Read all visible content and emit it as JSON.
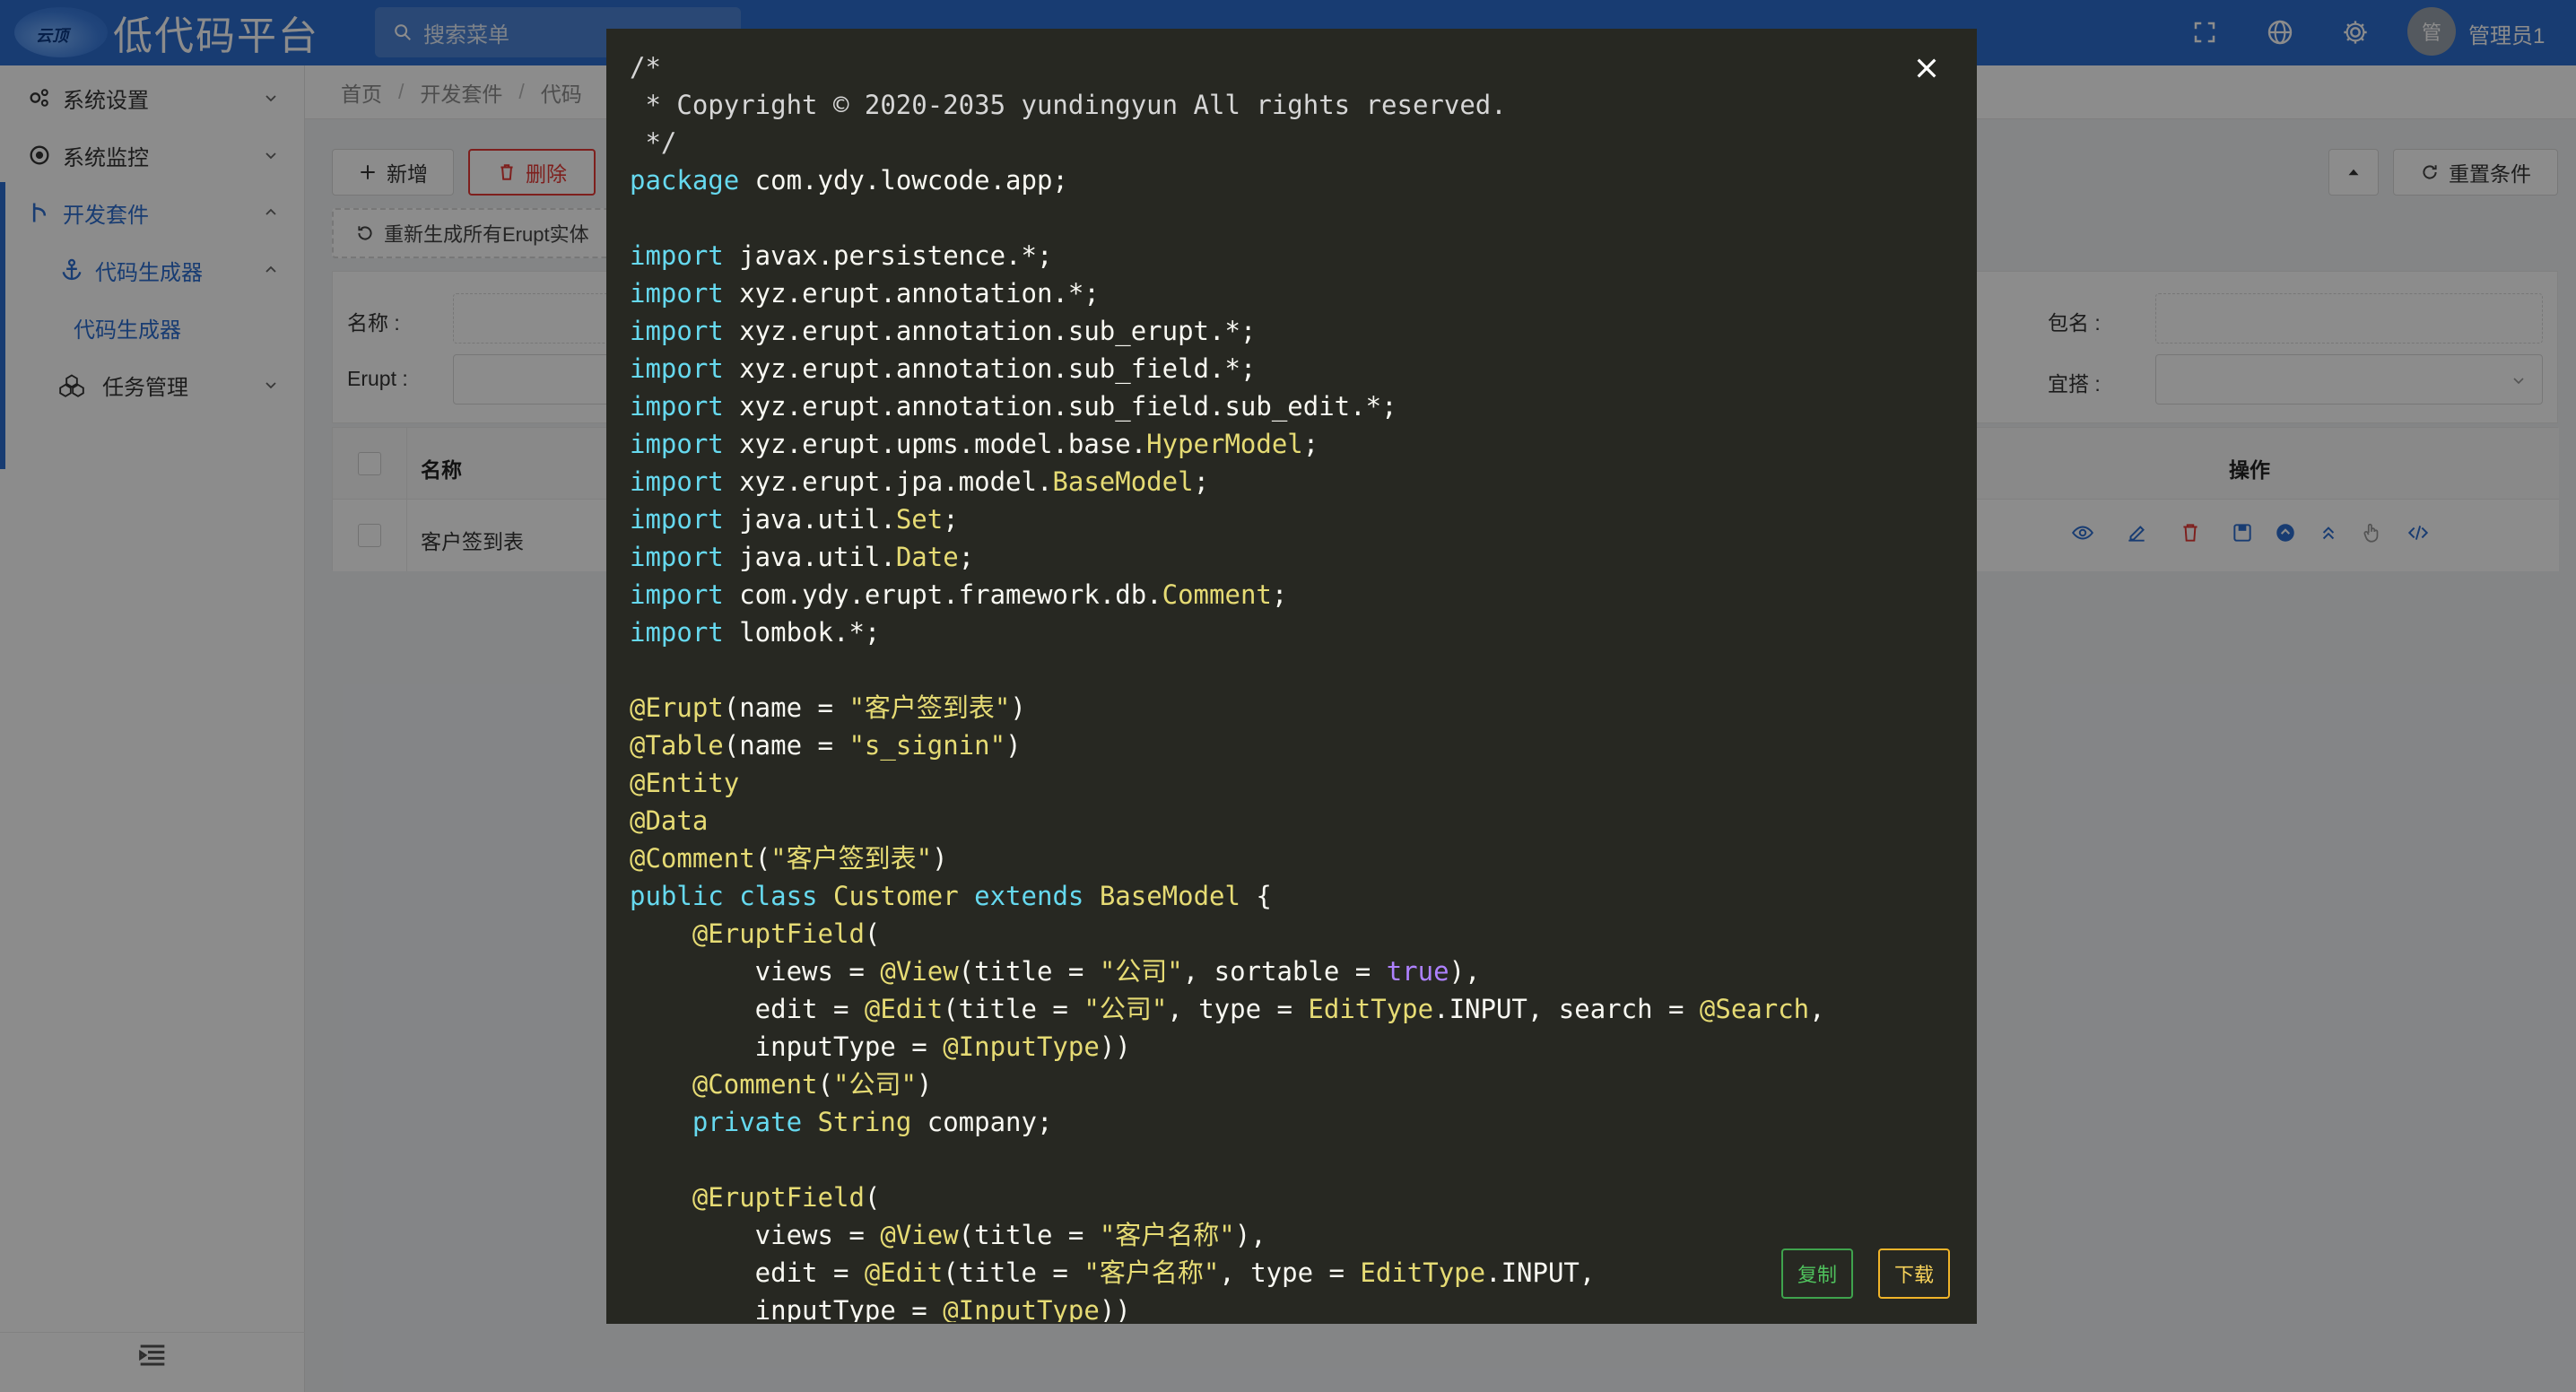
{
  "header": {
    "logo_text": "云顶",
    "app_title": "低代码平台",
    "search_placeholder": "搜索菜单",
    "avatar_text": "管",
    "user_name": "管理员1"
  },
  "sidebar": {
    "items": [
      {
        "label": "系统设置",
        "icon": "cogs-icon",
        "arrow": "down"
      },
      {
        "label": "系统监控",
        "icon": "monitor-icon",
        "arrow": "down"
      },
      {
        "label": "开发套件",
        "icon": "fork-icon",
        "arrow": "up"
      },
      {
        "label": "代码生成器",
        "icon": "anchor-icon",
        "arrow": "up"
      },
      {
        "label": "代码生成器",
        "icon": "",
        "arrow": ""
      },
      {
        "label": "任务管理",
        "icon": "tasks-icon",
        "arrow": "down"
      }
    ]
  },
  "breadcrumb": [
    "首页",
    "开发套件",
    "代码"
  ],
  "toolbar": {
    "add_label": "新增",
    "delete_label": "删除",
    "regen_label": "重新生成所有Erupt实体",
    "reset_label": "重置条件"
  },
  "search_form": {
    "name_label": "名称 :",
    "erupt_label": "Erupt :",
    "package_label": "包名 :",
    "suitable_label": "宜搭 :"
  },
  "table": {
    "headers": [
      "名称",
      "操作"
    ],
    "rows": [
      {
        "name": "客户签到表"
      }
    ]
  },
  "modal": {
    "copy_label": "复制",
    "download_label": "下载",
    "code_lines": [
      [
        [
          "c-cm",
          "/*"
        ]
      ],
      [
        [
          "c-cm",
          " * Copyright © 2020-2035 yundingyun All rights reserved."
        ]
      ],
      [
        [
          "c-cm",
          " */"
        ]
      ],
      [
        [
          "c-kw",
          "package"
        ],
        [
          "",
          " com.ydy.lowcode.app;"
        ]
      ],
      [
        [
          "",
          ""
        ]
      ],
      [
        [
          "c-kw",
          "import"
        ],
        [
          "",
          " javax.persistence.*;"
        ]
      ],
      [
        [
          "c-kw",
          "import"
        ],
        [
          "",
          " xyz.erupt.annotation.*;"
        ]
      ],
      [
        [
          "c-kw",
          "import"
        ],
        [
          "",
          " xyz.erupt.annotation.sub_erupt.*;"
        ]
      ],
      [
        [
          "c-kw",
          "import"
        ],
        [
          "",
          " xyz.erupt.annotation.sub_field.*;"
        ]
      ],
      [
        [
          "c-kw",
          "import"
        ],
        [
          "",
          " xyz.erupt.annotation.sub_field.sub_edit.*;"
        ]
      ],
      [
        [
          "c-kw",
          "import"
        ],
        [
          "",
          " xyz.erupt.upms.model.base."
        ],
        [
          "c-ty",
          "HyperModel"
        ],
        [
          "",
          ";"
        ]
      ],
      [
        [
          "c-kw",
          "import"
        ],
        [
          "",
          " xyz.erupt.jpa.model."
        ],
        [
          "c-ty",
          "BaseModel"
        ],
        [
          "",
          ";"
        ]
      ],
      [
        [
          "c-kw",
          "import"
        ],
        [
          "",
          " java.util."
        ],
        [
          "c-ty",
          "Set"
        ],
        [
          "",
          ";"
        ]
      ],
      [
        [
          "c-kw",
          "import"
        ],
        [
          "",
          " java.util."
        ],
        [
          "c-ty",
          "Date"
        ],
        [
          "",
          ";"
        ]
      ],
      [
        [
          "c-kw",
          "import"
        ],
        [
          "",
          " com.ydy.erupt.framework.db."
        ],
        [
          "c-ty",
          "Comment"
        ],
        [
          "",
          ";"
        ]
      ],
      [
        [
          "c-kw",
          "import"
        ],
        [
          "",
          " lombok.*;"
        ]
      ],
      [
        [
          "",
          ""
        ]
      ],
      [
        [
          "c-an",
          "@Erupt"
        ],
        [
          "",
          "(name = "
        ],
        [
          "c-st",
          "\"客户签到表\""
        ],
        [
          "",
          ")"
        ]
      ],
      [
        [
          "c-an",
          "@Table"
        ],
        [
          "",
          "(name = "
        ],
        [
          "c-st",
          "\"s_signin\""
        ],
        [
          "",
          ")"
        ]
      ],
      [
        [
          "c-an",
          "@Entity"
        ]
      ],
      [
        [
          "c-an",
          "@Data"
        ]
      ],
      [
        [
          "c-an",
          "@Comment"
        ],
        [
          "",
          "("
        ],
        [
          "c-st",
          "\"客户签到表\""
        ],
        [
          "",
          ")"
        ]
      ],
      [
        [
          "c-kw",
          "public class"
        ],
        [
          "",
          " "
        ],
        [
          "c-ty",
          "Customer"
        ],
        [
          "",
          " "
        ],
        [
          "c-kw",
          "extends"
        ],
        [
          "",
          " "
        ],
        [
          "c-ty",
          "BaseModel"
        ],
        [
          "",
          " {"
        ]
      ],
      [
        [
          "",
          "    "
        ],
        [
          "c-an",
          "@EruptField"
        ],
        [
          "",
          "("
        ]
      ],
      [
        [
          "",
          "        views = "
        ],
        [
          "c-an",
          "@View"
        ],
        [
          "",
          "(title = "
        ],
        [
          "c-st",
          "\"公司\""
        ],
        [
          "",
          ", sortable = "
        ],
        [
          "c-lt",
          "true"
        ],
        [
          "",
          "),"
        ]
      ],
      [
        [
          "",
          "        edit = "
        ],
        [
          "c-an",
          "@Edit"
        ],
        [
          "",
          "(title = "
        ],
        [
          "c-st",
          "\"公司\""
        ],
        [
          "",
          ", type = "
        ],
        [
          "c-ty",
          "EditType"
        ],
        [
          "",
          ".INPUT, search = "
        ],
        [
          "c-an",
          "@Search"
        ],
        [
          "",
          ","
        ]
      ],
      [
        [
          "",
          "        inputType = "
        ],
        [
          "c-an",
          "@InputType"
        ],
        [
          "",
          "))"
        ]
      ],
      [
        [
          "",
          "    "
        ],
        [
          "c-an",
          "@Comment"
        ],
        [
          "",
          "("
        ],
        [
          "c-st",
          "\"公司\""
        ],
        [
          "",
          ")"
        ]
      ],
      [
        [
          "",
          "    "
        ],
        [
          "c-kw",
          "private"
        ],
        [
          "",
          " "
        ],
        [
          "c-ty",
          "String"
        ],
        [
          "",
          " company;"
        ]
      ],
      [
        [
          "",
          ""
        ]
      ],
      [
        [
          "",
          "    "
        ],
        [
          "c-an",
          "@EruptField"
        ],
        [
          "",
          "("
        ]
      ],
      [
        [
          "",
          "        views = "
        ],
        [
          "c-an",
          "@View"
        ],
        [
          "",
          "(title = "
        ],
        [
          "c-st",
          "\"客户名称\""
        ],
        [
          "",
          "),"
        ]
      ],
      [
        [
          "",
          "        edit = "
        ],
        [
          "c-an",
          "@Edit"
        ],
        [
          "",
          "(title = "
        ],
        [
          "c-st",
          "\"客户名称\""
        ],
        [
          "",
          ", type = "
        ],
        [
          "c-ty",
          "EditType"
        ],
        [
          "",
          ".INPUT,"
        ]
      ],
      [
        [
          "",
          "        inputType = "
        ],
        [
          "c-an",
          "@InputType"
        ],
        [
          "",
          "))"
        ]
      ]
    ]
  }
}
